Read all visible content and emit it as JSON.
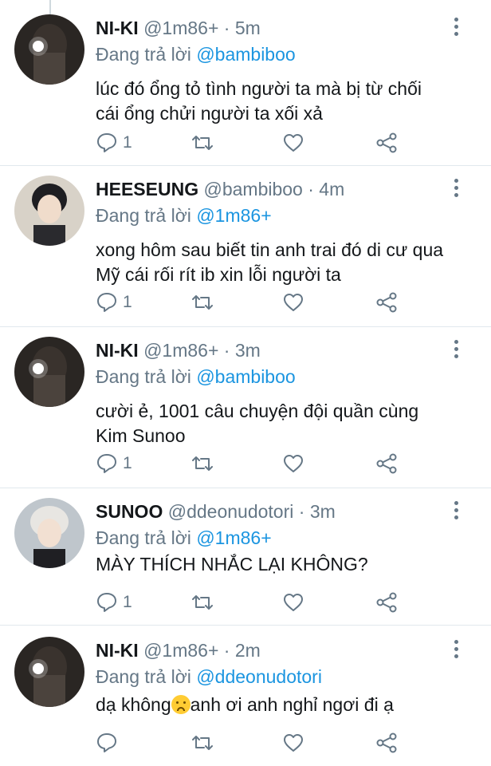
{
  "tweets": [
    {
      "name": "NI-KI",
      "handle": "@1m86+",
      "time": " · 5m",
      "reply_prefix": "Đang trả lời ",
      "reply_to": "@bambiboo",
      "lines": [
        "lúc đó ổng tỏ tình người ta mà bị từ chối",
        "cái ổng chửi người ta xối xả"
      ],
      "reply_count": "1"
    },
    {
      "name": "HEESEUNG",
      "handle": "@bambiboo",
      "time": " · 4m",
      "reply_prefix": "Đang trả lời ",
      "reply_to": "@1m86+",
      "lines": [
        "xong hôm sau biết tin anh trai đó di cư qua",
        "Mỹ cái rối rít ib xin lỗi người ta"
      ],
      "reply_count": "1"
    },
    {
      "name": "NI-KI",
      "handle": "@1m86+",
      "time": " · 3m",
      "reply_prefix": "Đang trả lời ",
      "reply_to": "@bambiboo",
      "lines": [
        "cười ẻ, 1001 câu chuyện đội quần cùng",
        "Kim Sunoo"
      ],
      "reply_count": "1"
    },
    {
      "name": "SUNOO",
      "handle": "@ddeonudotori",
      "time": " · 3m",
      "reply_prefix": "Đang trả lời ",
      "reply_to": "@1m86+",
      "lines": [
        "MÀY THÍCH NHẮC LẠI KHÔNG?"
      ],
      "reply_count": "1"
    },
    {
      "name": "NI-KI",
      "handle": "@1m86+",
      "time": " · 2m",
      "reply_prefix": "Đang trả lời ",
      "reply_to": "@ddeonudotori",
      "line_before_emoji": "dạ không",
      "emoji": "sad-face-emoji",
      "line_after_emoji": "anh ơi anh nghỉ ngơi đi ạ",
      "reply_count": ""
    }
  ],
  "colors": {
    "text": "#14171a",
    "secondary": "#657786",
    "link": "#1b95e0",
    "divider": "#e1e8ed"
  },
  "icons": [
    "reply-icon",
    "retweet-icon",
    "like-icon",
    "share-icon",
    "more-options-icon"
  ]
}
